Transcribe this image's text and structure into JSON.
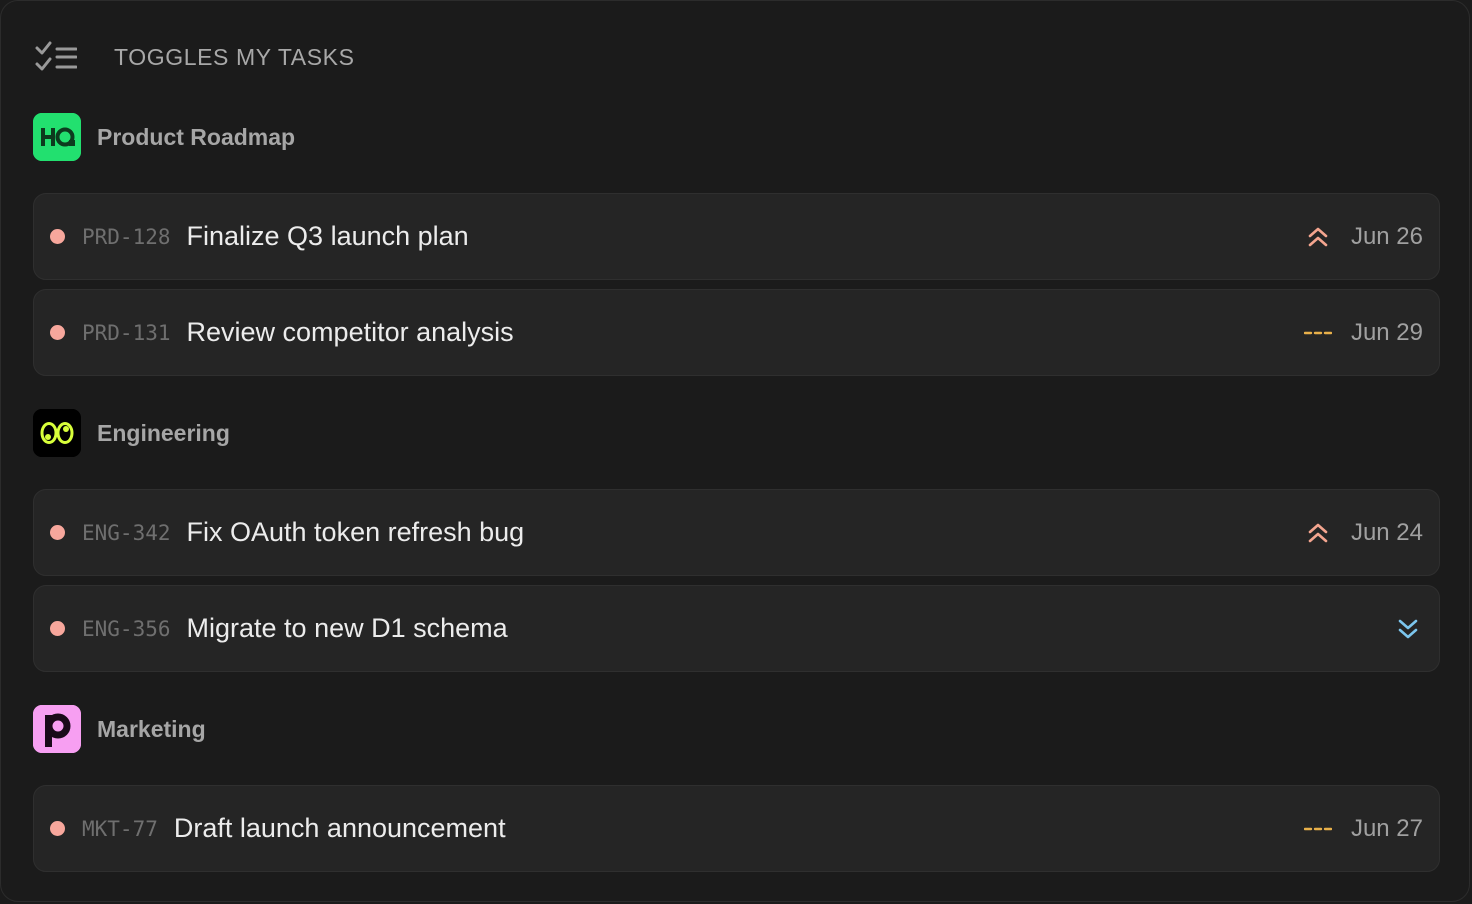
{
  "header": {
    "icon": "checklist-icon",
    "title": "TOGGLES MY TASKS"
  },
  "colors": {
    "status_dot": "#f7a79c",
    "priority_high": "#f4a58f",
    "priority_none": "#e8b04a",
    "priority_low": "#7cc6ee",
    "product_icon_bg": "#22e06f",
    "engineering_icon_bg": "#000000",
    "engineering_icon_fg": "#d8ff3a",
    "marketing_icon_bg": "#f79ff2"
  },
  "groups": [
    {
      "name": "Product Roadmap",
      "icon": "hq-logo-icon",
      "tasks": [
        {
          "id": "PRD-128",
          "title": "Finalize Q3 launch plan",
          "priority": "high",
          "priority_icon": "chevrons-up-icon",
          "due": "Jun 26"
        },
        {
          "id": "PRD-131",
          "title": "Review competitor analysis",
          "priority": "none",
          "priority_icon": "dashes-icon",
          "due": "Jun 29"
        }
      ]
    },
    {
      "name": "Engineering",
      "icon": "eyes-logo-icon",
      "tasks": [
        {
          "id": "ENG-342",
          "title": "Fix OAuth token refresh bug",
          "priority": "high",
          "priority_icon": "chevrons-up-icon",
          "due": "Jun 24"
        },
        {
          "id": "ENG-356",
          "title": "Migrate to new D1 schema",
          "priority": "low",
          "priority_icon": "chevrons-down-icon",
          "due": ""
        }
      ]
    },
    {
      "name": "Marketing",
      "icon": "p-logo-icon",
      "icon_letter": "p",
      "tasks": [
        {
          "id": "MKT-77",
          "title": "Draft launch announcement",
          "priority": "none",
          "priority_icon": "dashes-icon",
          "due": "Jun 27"
        }
      ]
    }
  ]
}
